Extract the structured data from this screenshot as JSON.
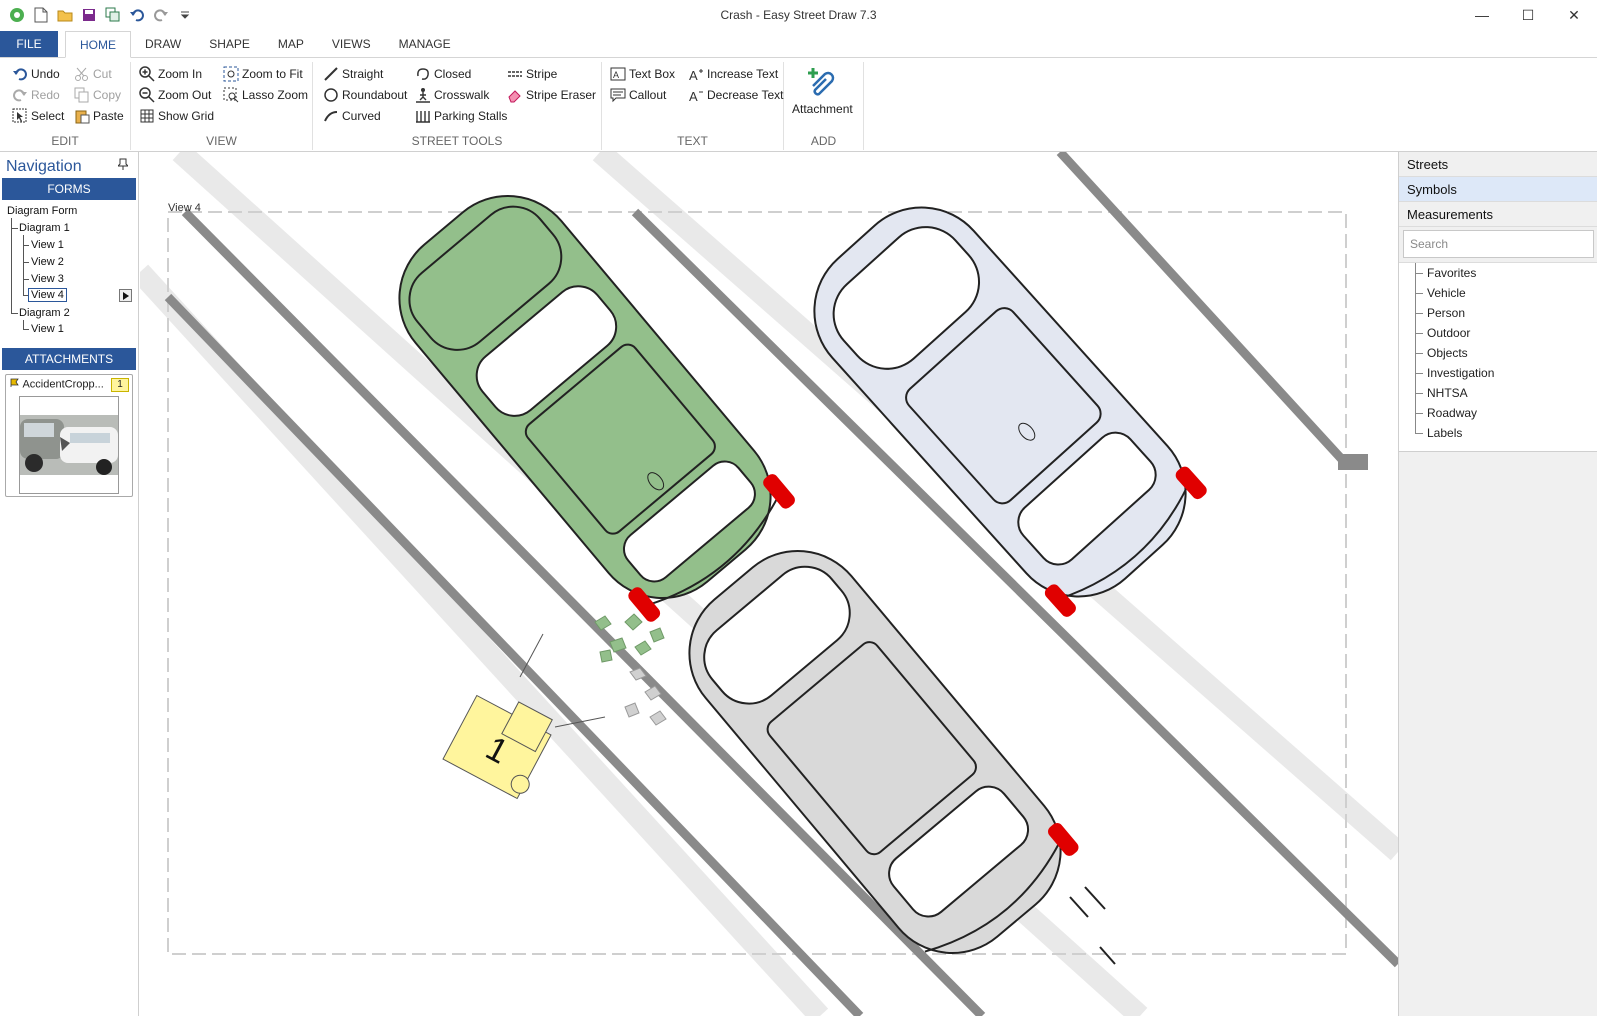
{
  "window": {
    "title": "Crash - Easy Street Draw 7.3",
    "controls": {
      "minimize": "—",
      "maximize": "☐",
      "close": "✕"
    }
  },
  "ribbon_tabs": [
    "FILE",
    "HOME",
    "DRAW",
    "SHAPE",
    "MAP",
    "VIEWS",
    "MANAGE"
  ],
  "active_tab": "HOME",
  "ribbon": {
    "edit": {
      "label": "EDIT",
      "undo": "Undo",
      "redo": "Redo",
      "select": "Select",
      "cut": "Cut",
      "copy": "Copy",
      "paste": "Paste"
    },
    "view": {
      "label": "VIEW",
      "zoom_in": "Zoom In",
      "zoom_out": "Zoom Out",
      "show_grid": "Show Grid",
      "zoom_to_fit": "Zoom to Fit",
      "lasso_zoom": "Lasso Zoom"
    },
    "street_tools": {
      "label": "STREET TOOLS",
      "straight": "Straight",
      "roundabout": "Roundabout",
      "curved": "Curved",
      "closed": "Closed",
      "crosswalk": "Crosswalk",
      "parking_stalls": "Parking Stalls",
      "stripe": "Stripe",
      "stripe_eraser": "Stripe Eraser"
    },
    "text": {
      "label": "TEXT",
      "text_box": "Text Box",
      "callout": "Callout",
      "increase_text": "Increase Text",
      "decrease_text": "Decrease Text"
    },
    "add": {
      "label": "ADD",
      "attachment": "Attachment"
    }
  },
  "navigation": {
    "title": "Navigation",
    "forms_header": "FORMS",
    "tree": {
      "root": "Diagram Form",
      "diagram1": "Diagram 1",
      "d1_views": [
        "View 1",
        "View 2",
        "View 3",
        "View 4"
      ],
      "diagram2": "Diagram 2",
      "d2_views": [
        "View 1"
      ]
    },
    "selected_view": "View 4",
    "attachments_header": "ATTACHMENTS",
    "attachment": {
      "name": "AccidentCropp...",
      "badge": "1"
    }
  },
  "canvas": {
    "view_label": "View 4",
    "evidence_marker": "1"
  },
  "right_panel": {
    "headers": [
      "Streets",
      "Symbols",
      "Measurements"
    ],
    "active": "Symbols",
    "search_placeholder": "Search",
    "categories": [
      "Favorites",
      "Vehicle",
      "Person",
      "Outdoor",
      "Objects",
      "Investigation",
      "NHTSA",
      "Roadway",
      "Labels"
    ]
  },
  "colors": {
    "brand_blue": "#2b579a",
    "car_green": "#93bf8b",
    "car_light_blue": "#e3e7f1",
    "car_gray": "#d9d9d9",
    "tail_red": "#e00000",
    "marker_yellow": "#fff59d",
    "road_line": "#8a8a8a"
  }
}
